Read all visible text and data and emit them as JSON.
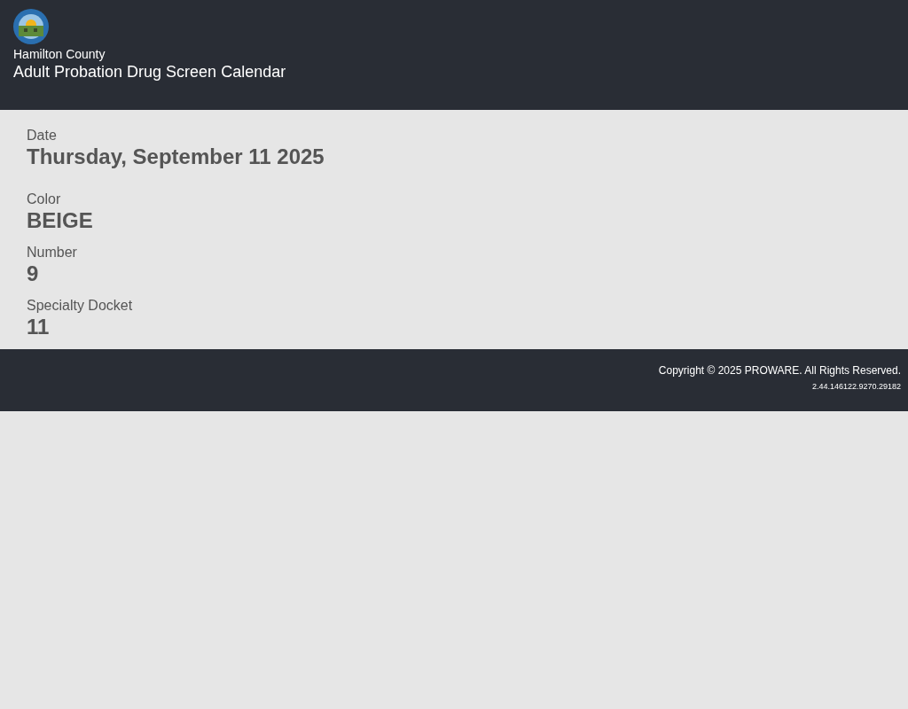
{
  "header": {
    "county": "Hamilton County",
    "title": "Adult Probation Drug Screen Calendar"
  },
  "fields": [
    {
      "label": "Date",
      "value": "Thursday, September 11 2025"
    },
    {
      "label": "Color",
      "value": "BEIGE"
    },
    {
      "label": "Number",
      "value": "9"
    },
    {
      "label": "Specialty Docket",
      "value": "11"
    }
  ],
  "footer": {
    "copyright": "Copyright © 2025 PROWARE. All Rights Reserved.",
    "version": "2.44.146122.9270.29182"
  }
}
